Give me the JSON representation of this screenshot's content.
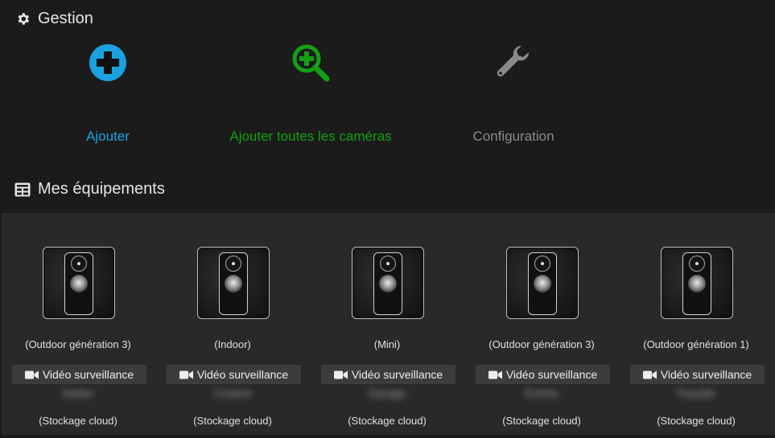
{
  "gestion": {
    "title": "Gestion",
    "actions": [
      {
        "label": "Ajouter",
        "color": "#1aa1e0",
        "icon": "plus-circle-icon"
      },
      {
        "label": "Ajouter toutes les caméras",
        "color": "#13a013",
        "icon": "zoom-in-icon"
      },
      {
        "label": "Configuration",
        "color": "#8a8a8a",
        "icon": "wrench-icon"
      }
    ]
  },
  "equipements": {
    "title": "Mes équipements",
    "items": [
      {
        "model": "(Outdoor génération 3)",
        "category": "Vidéo surveillance",
        "name": "Atelier",
        "storage": "(Stockage cloud)"
      },
      {
        "model": "(Indoor)",
        "category": "Vidéo surveillance",
        "name": "Cuisine",
        "storage": "(Stockage cloud)"
      },
      {
        "model": "(Mini)",
        "category": "Vidéo surveillance",
        "name": "Garage",
        "storage": "(Stockage cloud)"
      },
      {
        "model": "(Outdoor génération 3)",
        "category": "Vidéo surveillance",
        "name": "Entrée",
        "storage": "(Stockage cloud)"
      },
      {
        "model": "(Outdoor génération 1)",
        "category": "Vidéo surveillance",
        "name": "Façade",
        "storage": "(Stockage cloud)"
      }
    ]
  }
}
